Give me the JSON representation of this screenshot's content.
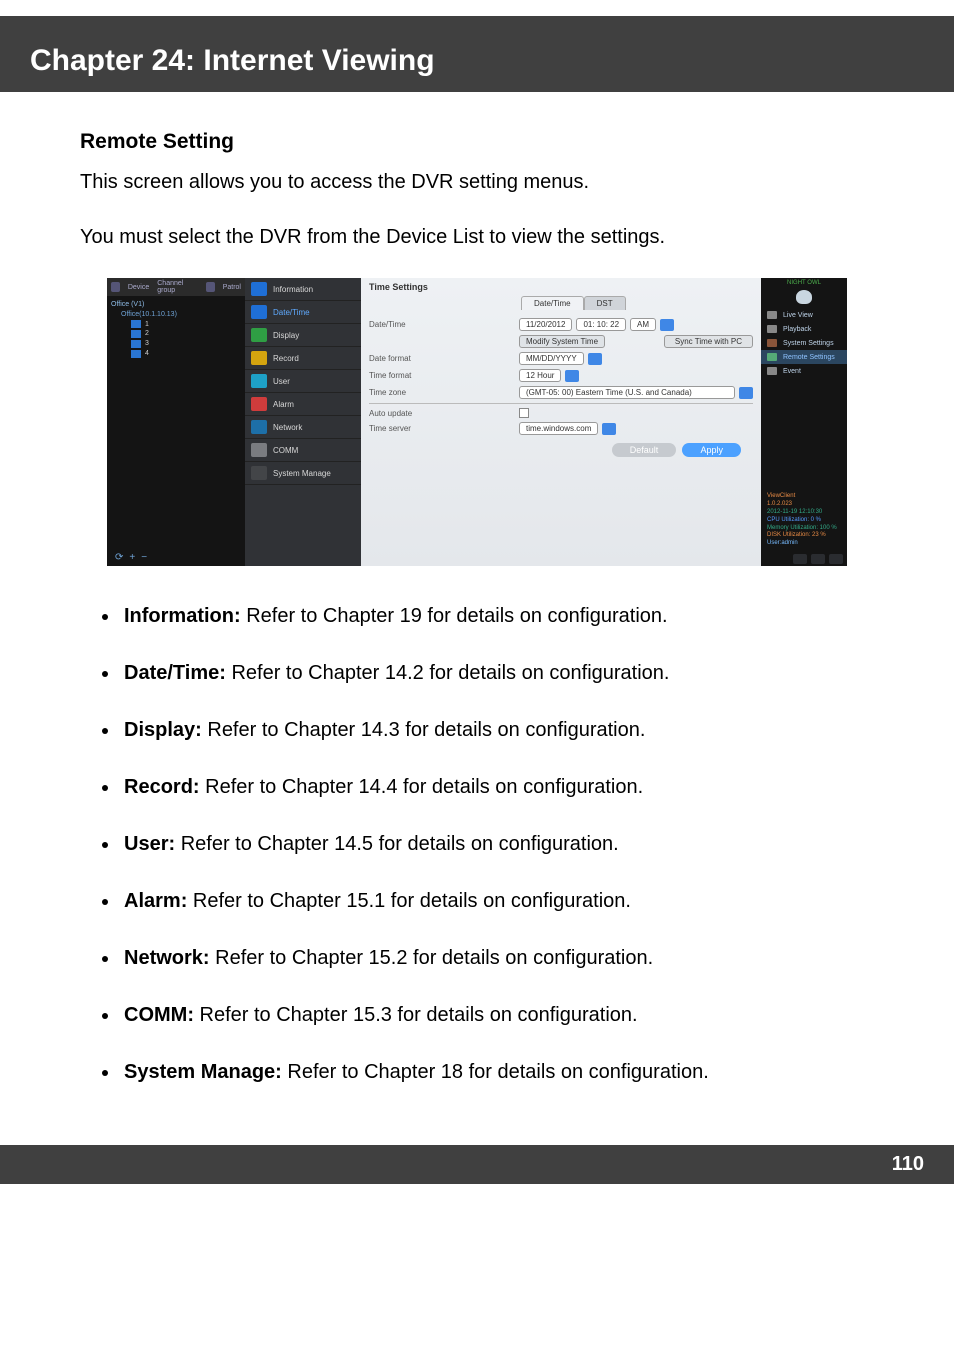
{
  "chapter_title": "Chapter 24: Internet Viewing",
  "section_title": "Remote Setting",
  "intro_1": "This screen allows you to access the DVR setting menus.",
  "intro_2": "You must select the DVR from the Device List to view the settings.",
  "left_tabs": {
    "a": "Device",
    "b": "Channel group",
    "c": "Patrol"
  },
  "device_tree": {
    "root": "Office (V1)",
    "sub": "Office(10.1.10.13)"
  },
  "left_btm": {
    "refresh": "⟳",
    "plus": "+",
    "minus": "−"
  },
  "menu": {
    "info": "Information",
    "date": "Date/Time",
    "disp": "Display",
    "rec": "Record",
    "usr": "User",
    "alm": "Alarm",
    "net": "Network",
    "comm": "COMM",
    "sys": "System Manage"
  },
  "panel": {
    "title": "Time Settings",
    "tab_dt": "Date/Time",
    "tab_dst": "DST",
    "row_dt": "Date/Time",
    "val_date": "11/20/2012",
    "val_time": "01: 10: 22",
    "val_ampm": "AM",
    "row_mod": "Modify System Time",
    "btn_sync": "Sync Time with PC",
    "row_fmt": "Date format",
    "val_fmt": "MM/DD/YYYY",
    "row_tf": "Time format",
    "val_tf": "12 Hour",
    "row_tz": "Time zone",
    "val_tz": "(GMT-05: 00) Eastern Time (U.S. and Canada)",
    "row_au": "Auto update",
    "row_ts": "Time server",
    "val_ts": "time.windows.com",
    "btn_def": "Default",
    "btn_app": "Apply"
  },
  "rightnav": {
    "brand": "NIGHT OWL",
    "live": "Live View",
    "play": "Playback",
    "sys": "System Settings",
    "rem": "Remote Settings",
    "ev": "Event"
  },
  "rinfo": {
    "name": "ViewClient",
    "ver": "1.0.2.023",
    "ts": "2012-11-19 12:10:30",
    "cpu": "CPU Utilization:    0 %",
    "mem": "Memory Utilization:  100 %",
    "dsk": "DISK Utilization:   23 %",
    "usr": "User:admin"
  },
  "bullets": [
    {
      "b": "Information:",
      "t": " Refer to Chapter 19 for details on configuration."
    },
    {
      "b": "Date/Time:",
      "t": " Refer to Chapter 14.2 for details on configuration."
    },
    {
      "b": "Display:",
      "t": " Refer to Chapter 14.3 for details on configuration."
    },
    {
      "b": "Record:",
      "t": " Refer to Chapter 14.4 for details on configuration."
    },
    {
      "b": "User:",
      "t": " Refer to Chapter 14.5 for details on configuration."
    },
    {
      "b": "Alarm:",
      "t": " Refer to Chapter 15.1 for details on configuration."
    },
    {
      "b": "Network:",
      "t": " Refer to Chapter 15.2 for details on configuration."
    },
    {
      "b": "COMM:",
      "t": " Refer to Chapter 15.3 for details on configuration."
    },
    {
      "b": "System Manage:",
      "t": " Refer to Chapter 18 for details on configuration."
    }
  ],
  "page_number": "110"
}
